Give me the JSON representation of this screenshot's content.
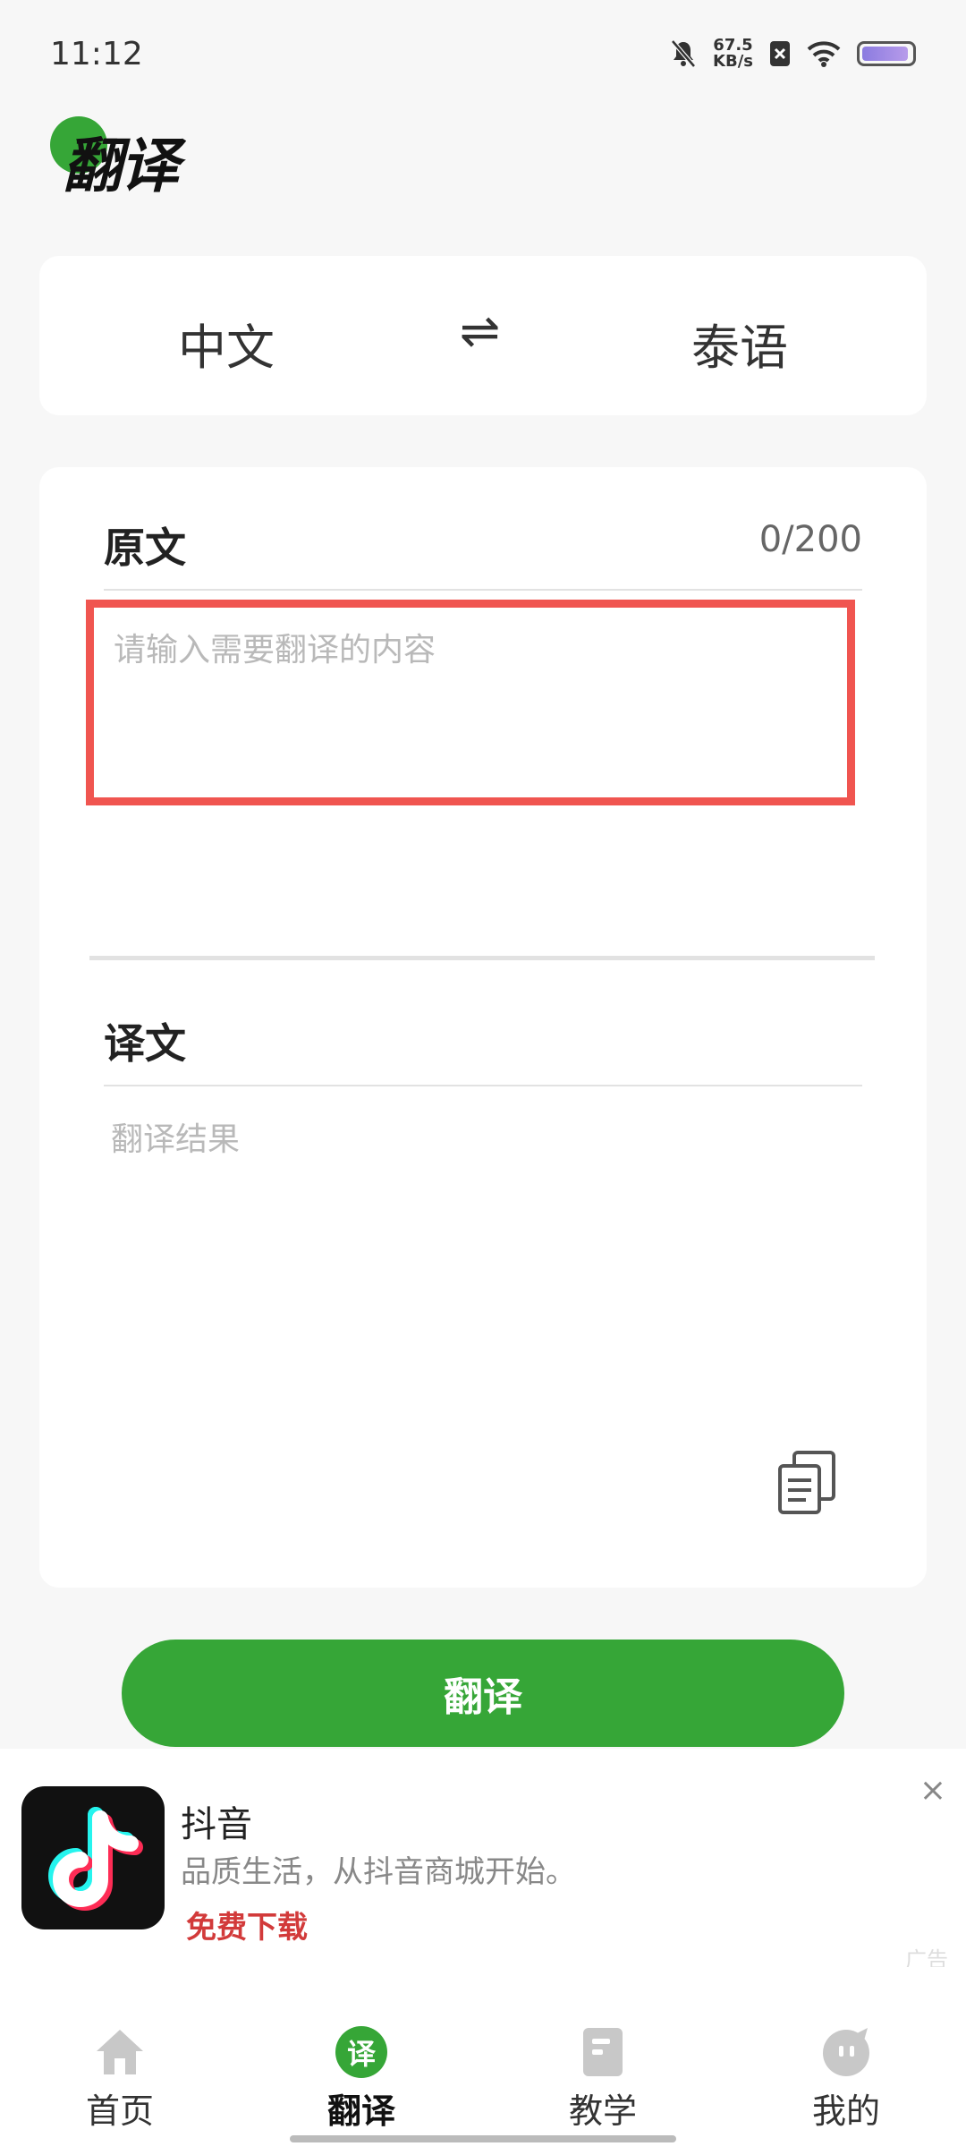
{
  "status_bar": {
    "time": "11:12",
    "speed_value": "67.5",
    "speed_unit": "KB/s",
    "battery_level": 0.95
  },
  "header": {
    "title": "翻译"
  },
  "languages": {
    "source": "中文",
    "swap_symbol": "⇌",
    "target": "泰语"
  },
  "source": {
    "label": "原文",
    "counter": "0/200",
    "value": "",
    "placeholder": "请输入需要翻译的内容"
  },
  "result": {
    "label": "译文",
    "placeholder": "翻译结果"
  },
  "translate_button": "翻译",
  "ad": {
    "close_symbol": "×",
    "app_name": "抖音",
    "description": "品质生活，从抖音商城开始。",
    "cta": "免费下载",
    "tag": "广告"
  },
  "nav": {
    "items": [
      {
        "label": "首页",
        "icon": "home-icon"
      },
      {
        "label": "翻译",
        "icon": "translate-icon",
        "badge": "译",
        "active": true
      },
      {
        "label": "教学",
        "icon": "book-icon"
      },
      {
        "label": "我的",
        "icon": "profile-icon"
      }
    ]
  },
  "colors": {
    "accent": "#36a637",
    "highlight_box": "#f05550",
    "ad_cta": "#d23a3a"
  }
}
